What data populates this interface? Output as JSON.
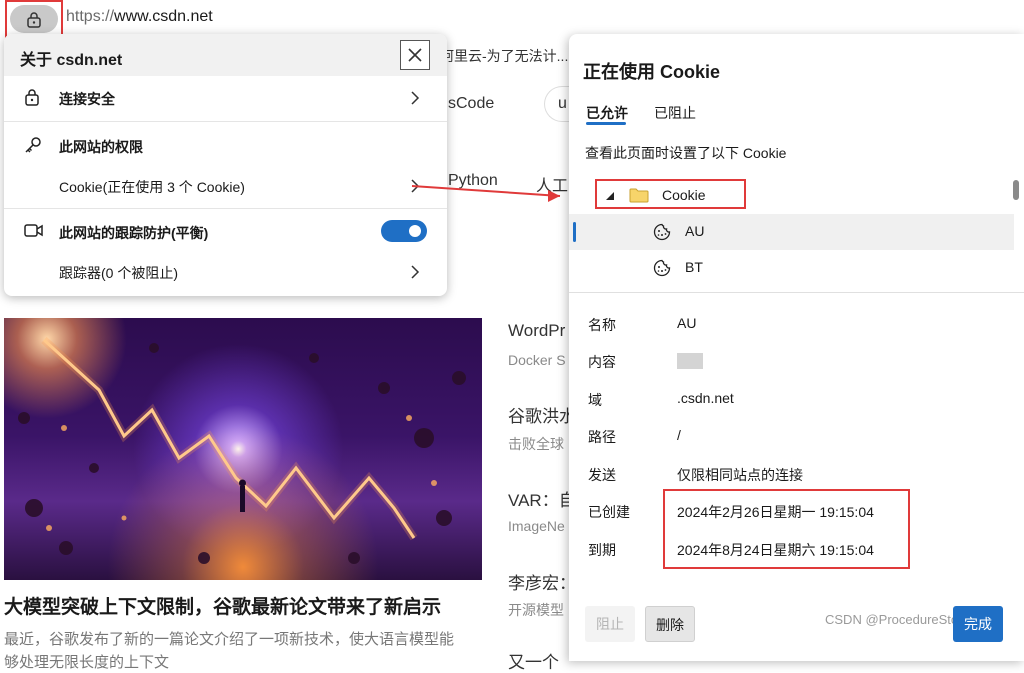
{
  "browser": {
    "url_scheme": "https://",
    "url_host": "www.csdn.net"
  },
  "background_page": {
    "tab_snippet": "阿里云-为了无法计...",
    "search_snippet": "sCode",
    "search_btn_snippet": "u",
    "nav_python": "Python",
    "nav_ai": "人工",
    "right_items": [
      {
        "title": "WordPr",
        "sub": "Docker S"
      },
      {
        "title": "谷歌洪水",
        "sub": "击败全球"
      },
      {
        "title": "VAR：自",
        "sub": "ImageNe"
      },
      {
        "title": "李彦宏：",
        "sub": "开源模型"
      },
      {
        "title": "又一个",
        "sub": ""
      }
    ],
    "article_title": "大模型突破上下文限制，谷歌最新论文带来了新启示",
    "article_summary_line1": "最近，谷歌发布了新的一篇论文介绍了一项新技术，使大语言模型能",
    "article_summary_line2": "够处理无限长度的上下文"
  },
  "site_info_popup": {
    "title": "关于 csdn.net",
    "connection": "连接安全",
    "permissions": "此网站的权限",
    "cookies": "Cookie(正在使用 3 个 Cookie)",
    "tracking": "此网站的跟踪防护(平衡)",
    "trackers": "跟踪器(0 个被阻止)",
    "tracking_enabled": true
  },
  "cookie_panel": {
    "title": "正在使用 Cookie",
    "tab_allowed": "已允许",
    "tab_blocked": "已阻止",
    "description": "查看此页面时设置了以下 Cookie",
    "tree": {
      "folder": "Cookie",
      "items": [
        "AU",
        "BT"
      ],
      "selected": "AU"
    },
    "details": [
      {
        "key": "名称",
        "value": "AU"
      },
      {
        "key": "内容",
        "value": ""
      },
      {
        "key": "域",
        "value": ".csdn.net"
      },
      {
        "key": "路径",
        "value": "/"
      },
      {
        "key": "发送",
        "value": "仅限相同站点的连接"
      },
      {
        "key": "已创建",
        "value": "2024年2月26日星期一 19:15:04"
      },
      {
        "key": "到期",
        "value": "2024年8月24日星期六 19:15:04"
      }
    ],
    "buttons": {
      "block": "阻止",
      "delete": "删除",
      "done": "完成"
    }
  },
  "watermark": "CSDN @ProcedureStone",
  "colors": {
    "accent": "#1f6fc5",
    "annotation_red": "#e03a3a"
  }
}
